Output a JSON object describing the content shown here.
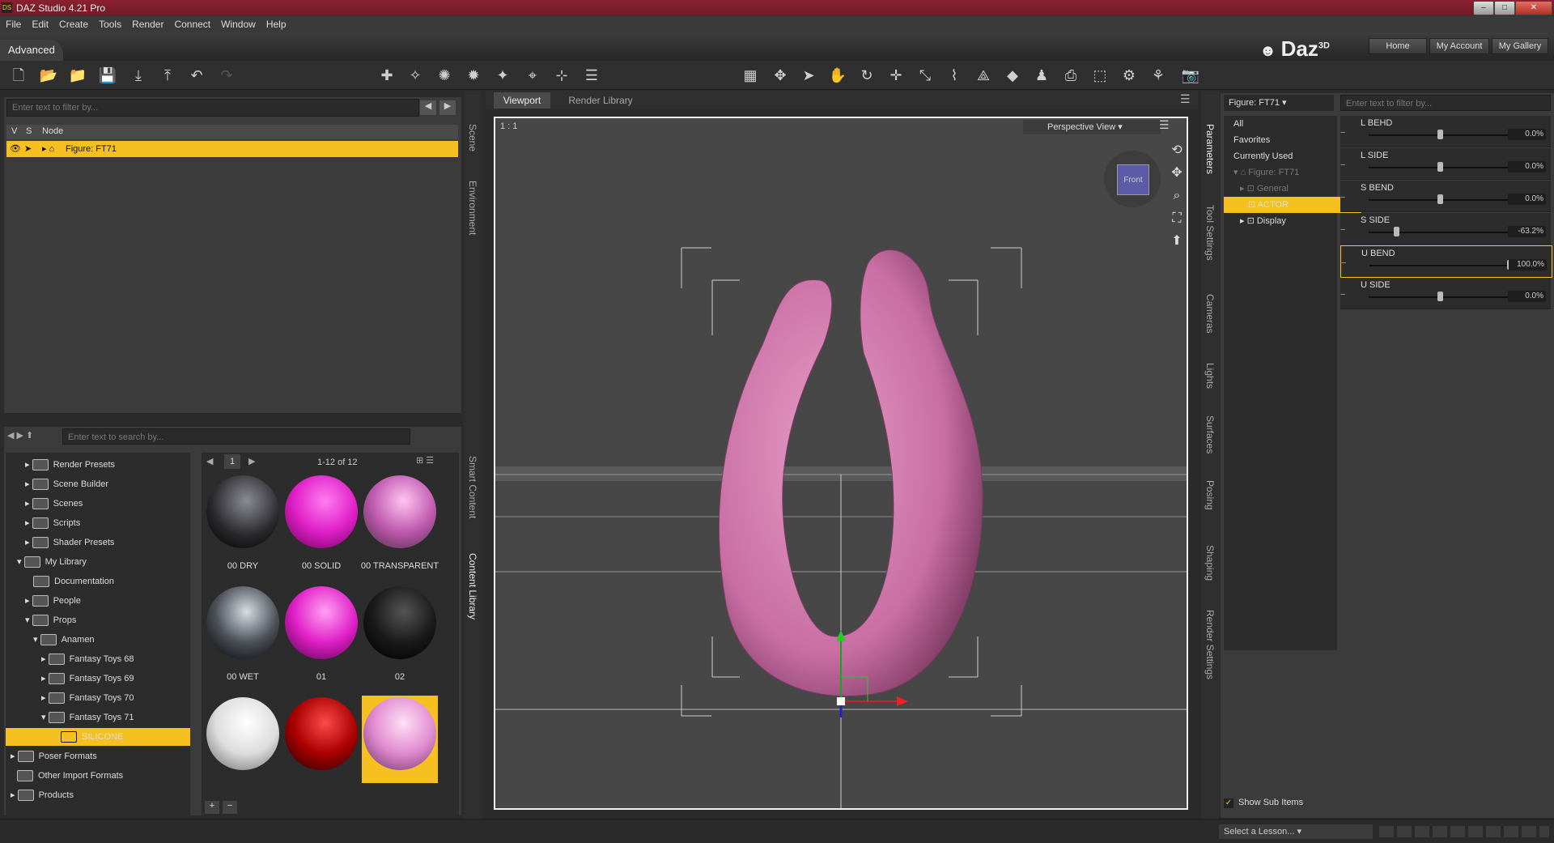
{
  "app": {
    "title": "DAZ Studio 4.21 Pro",
    "logo": "DS"
  },
  "menu": [
    "File",
    "Edit",
    "Create",
    "Tools",
    "Render",
    "Connect",
    "Window",
    "Help"
  ],
  "layout": {
    "tab": "Advanced",
    "buttons": [
      "Home",
      "My Account",
      "My Gallery"
    ],
    "brand": "Daz",
    "brand_sup": "3D"
  },
  "scene": {
    "filter_placeholder": "Enter text to filter by...",
    "cols": [
      "V",
      "S",
      "Node"
    ],
    "rows": [
      {
        "label": "Figure: FT71"
      }
    ]
  },
  "content": {
    "search_placeholder": "Enter text to search by...",
    "tree": [
      {
        "label": "Render Presets"
      },
      {
        "label": "Scene Builder"
      },
      {
        "label": "Scenes"
      },
      {
        "label": "Scripts"
      },
      {
        "label": "Shader Presets"
      },
      {
        "label": "My Library"
      },
      {
        "label": "Documentation"
      },
      {
        "label": "People"
      },
      {
        "label": "Props"
      },
      {
        "label": "Anamen"
      },
      {
        "label": "Fantasy Toys 68"
      },
      {
        "label": "Fantasy Toys 69"
      },
      {
        "label": "Fantasy Toys 70"
      },
      {
        "label": "Fantasy Toys 71"
      },
      {
        "label": "SILICONE"
      },
      {
        "label": "Poser Formats"
      },
      {
        "label": "Other Import Formats"
      },
      {
        "label": "Products"
      }
    ],
    "page": "1",
    "count": "1-12 of 12",
    "thumbs": [
      {
        "label": "00 DRY"
      },
      {
        "label": "00 SOLID"
      },
      {
        "label": "00 TRANSPARENT"
      },
      {
        "label": "00 WET"
      },
      {
        "label": "01"
      },
      {
        "label": "02"
      },
      {
        "label": ""
      },
      {
        "label": ""
      },
      {
        "label": ""
      }
    ],
    "add": "+",
    "remove": "−"
  },
  "side_tabs_left": [
    "Scene",
    "Environment",
    "Smart Content",
    "Content Library"
  ],
  "viewport": {
    "tabs": [
      "Viewport",
      "Render Library"
    ],
    "ratio": "1 : 1",
    "view": "Perspective View",
    "cube": "Front"
  },
  "side_tabs_right": [
    "Parameters",
    "Tool Settings",
    "Cameras",
    "Lights",
    "Surfaces",
    "Posing",
    "Shaping",
    "Render Settings"
  ],
  "parameters": {
    "figure": "Figure: FT71",
    "filter_placeholder": "Enter text to filter by...",
    "sets": [
      "All",
      "Favorites",
      "Currently Used",
      "Figure: FT71",
      "General",
      "ACTOR",
      "Display"
    ],
    "show_sub": "Show Sub Items",
    "items": [
      {
        "name": "L BEHD",
        "value": "0.0%",
        "fraction": 0.5
      },
      {
        "name": "L SIDE",
        "value": "0.0%",
        "fraction": 0.5
      },
      {
        "name": "S BEND",
        "value": "0.0%",
        "fraction": 0.5
      },
      {
        "name": "S SIDE",
        "value": "-63.2%",
        "fraction": 0.18
      },
      {
        "name": "U BEND",
        "value": "100.0%",
        "fraction": 1.0
      },
      {
        "name": "U SIDE",
        "value": "0.0%",
        "fraction": 0.5
      }
    ]
  },
  "lesson": "Select a Lesson..."
}
